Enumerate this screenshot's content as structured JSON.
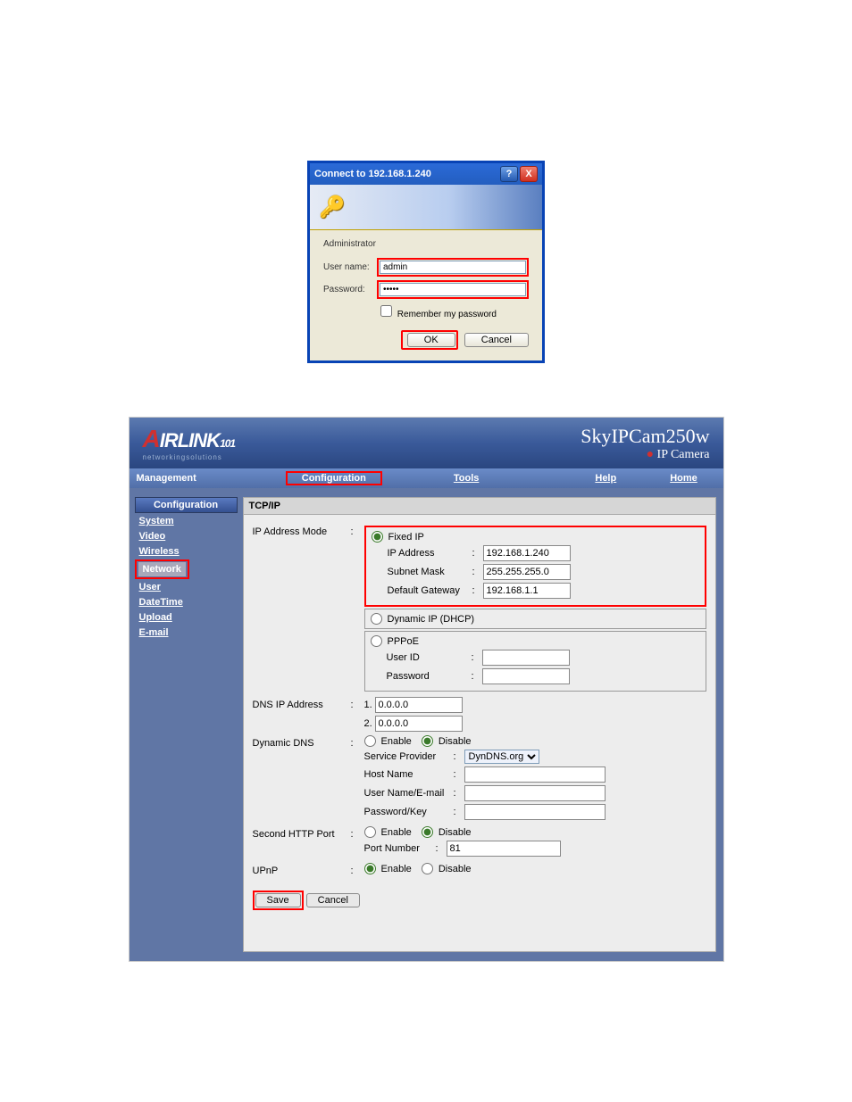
{
  "auth": {
    "title": "Connect to 192.168.1.240",
    "info": "Administrator",
    "username_label": "User name:",
    "password_label": "Password:",
    "username_value": "admin",
    "password_value": "•••••",
    "remember_label": "Remember my password",
    "ok": "OK",
    "cancel": "Cancel"
  },
  "cam": {
    "logo_main": "IRLINK",
    "logo_suffix": "101",
    "logo_sub": "networkingsolutions",
    "product": "SkyIPCam250w",
    "product_sub": "IP Camera",
    "nav": {
      "management": "Management",
      "configuration": "Configuration",
      "tools": "Tools",
      "help": "Help",
      "home": "Home"
    },
    "sidebar": {
      "title": "Configuration",
      "items": [
        "System",
        "Video",
        "Wireless",
        "Network",
        "User",
        "DateTime",
        "Upload",
        "E-mail"
      ],
      "active": "Network"
    },
    "section": "TCP/IP",
    "ip_mode": {
      "label": "IP Address Mode",
      "fixed": "Fixed IP",
      "ip_label": "IP Address",
      "ip_value": "192.168.1.240",
      "mask_label": "Subnet Mask",
      "mask_value": "255.255.255.0",
      "gw_label": "Default Gateway",
      "gw_value": "192.168.1.1",
      "dhcp": "Dynamic IP (DHCP)",
      "pppoe": "PPPoE",
      "uid_label": "User ID",
      "pwd_label": "Password"
    },
    "dns": {
      "label": "DNS IP Address",
      "v1": "0.0.0.0",
      "v2": "0.0.0.0"
    },
    "ddns": {
      "label": "Dynamic DNS",
      "enable": "Enable",
      "disable": "Disable",
      "sp_label": "Service Provider",
      "sp_value": "DynDNS.org",
      "host_label": "Host Name",
      "user_label": "User Name/E-mail",
      "key_label": "Password/Key"
    },
    "http": {
      "label": "Second HTTP Port",
      "enable": "Enable",
      "disable": "Disable",
      "port_label": "Port Number",
      "port_value": "81"
    },
    "upnp": {
      "label": "UPnP",
      "enable": "Enable",
      "disable": "Disable"
    },
    "save": "Save",
    "cancel": "Cancel"
  }
}
